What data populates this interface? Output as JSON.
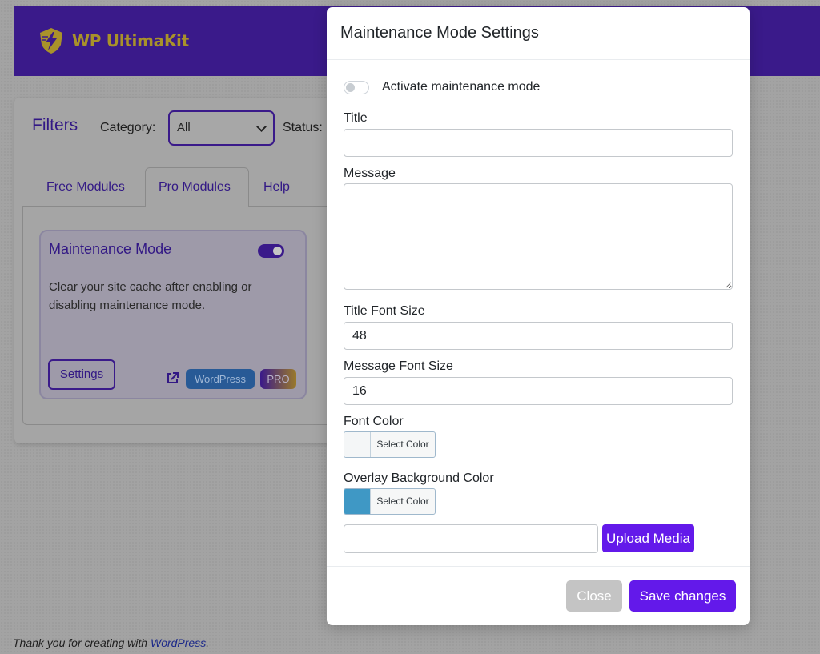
{
  "brand": {
    "name": "WP UltimaKit"
  },
  "filters": {
    "title": "Filters",
    "category_label": "Category:",
    "category_value": "All",
    "status_label": "Status:"
  },
  "tabs": [
    {
      "label": "Free Modules",
      "active": false
    },
    {
      "label": "Pro Modules",
      "active": true
    },
    {
      "label": "Help",
      "active": false
    }
  ],
  "module_card": {
    "title": "Maintenance Mode",
    "enabled": true,
    "description": "Clear your site cache after enabling or disabling maintenance mode.",
    "settings_label": "Settings",
    "badge_wordpress": "WordPress",
    "badge_pro": "PRO"
  },
  "footer": {
    "text": "Thank you for creating with",
    "link": "WordPress",
    "suffix": "."
  },
  "modal": {
    "title": "Maintenance Mode Settings",
    "activate_label": "Activate maintenance mode",
    "activate_on": false,
    "title_label": "Title",
    "title_value": "",
    "message_label": "Message",
    "message_value": "",
    "title_font_size_label": "Title Font Size",
    "title_font_size_value": "48",
    "message_font_size_label": "Message Font Size",
    "message_font_size_value": "16",
    "font_color_label": "Font Color",
    "font_color_swatch": "#f4f6f7",
    "select_color_label": "Select Color",
    "overlay_color_label": "Overlay Background Color",
    "overlay_color_swatch": "#3f98c5",
    "upload_value": "",
    "upload_label": "Upload Media",
    "close_label": "Close",
    "save_label": "Save changes"
  },
  "colors": {
    "brand_purple": "#6319ea",
    "header_bg": "#3a1a8a"
  }
}
